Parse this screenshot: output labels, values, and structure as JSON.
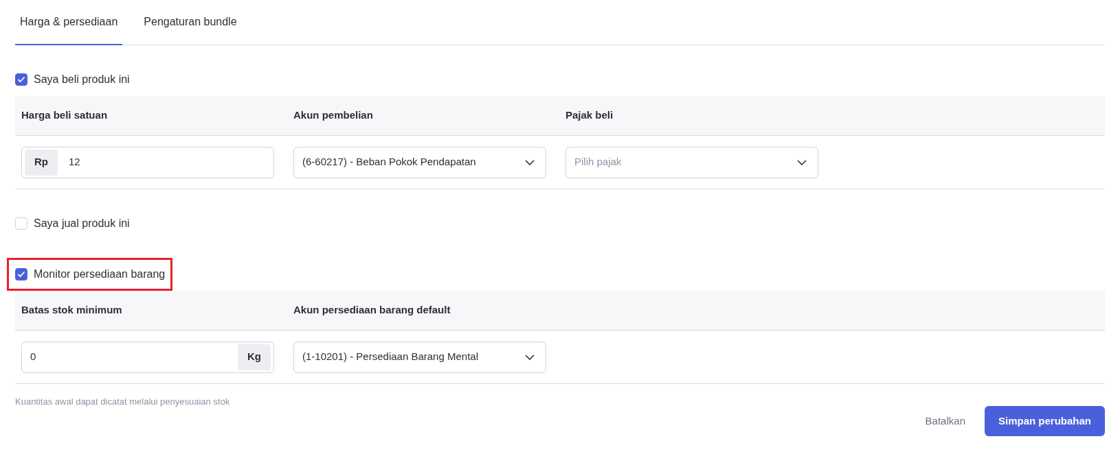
{
  "tabs": [
    {
      "label": "Harga & persediaan",
      "selected": true
    },
    {
      "label": "Pengaturan bundle",
      "selected": false
    }
  ],
  "sections": [
    {
      "label": "Saya beli produk ini",
      "checked": true,
      "highlighted": false,
      "columns": [
        {
          "header": "Harga beli satuan",
          "field": {
            "kind": "prefix",
            "addon": "Rp",
            "value": "12"
          }
        },
        {
          "header": "Akun pembelian",
          "field": {
            "kind": "select",
            "value": "(6-60217) - Beban Pokok Pendapatan"
          }
        },
        {
          "header": "Pajak beli",
          "field": {
            "kind": "select",
            "placeholder": "Pilih pajak"
          }
        }
      ]
    },
    {
      "label": "Saya jual produk ini",
      "checked": false,
      "highlighted": false
    },
    {
      "label": "Monitor persediaan barang",
      "checked": true,
      "highlighted": true,
      "columns": [
        {
          "header": "Batas stok minimum",
          "field": {
            "kind": "suffix",
            "addon": "Kg",
            "value": "0"
          }
        },
        {
          "header": "Akun persediaan barang default",
          "field": {
            "kind": "select",
            "value": "(1-10201) - Persediaan Barang Mental"
          }
        }
      ],
      "note": "Kuantitas awal dapat dicatat melalui penyesuaian stok"
    }
  ],
  "buttons": [
    {
      "label": "Batalkan",
      "kind": "link"
    },
    {
      "label": "Simpan perubahan",
      "kind": "primary"
    }
  ]
}
